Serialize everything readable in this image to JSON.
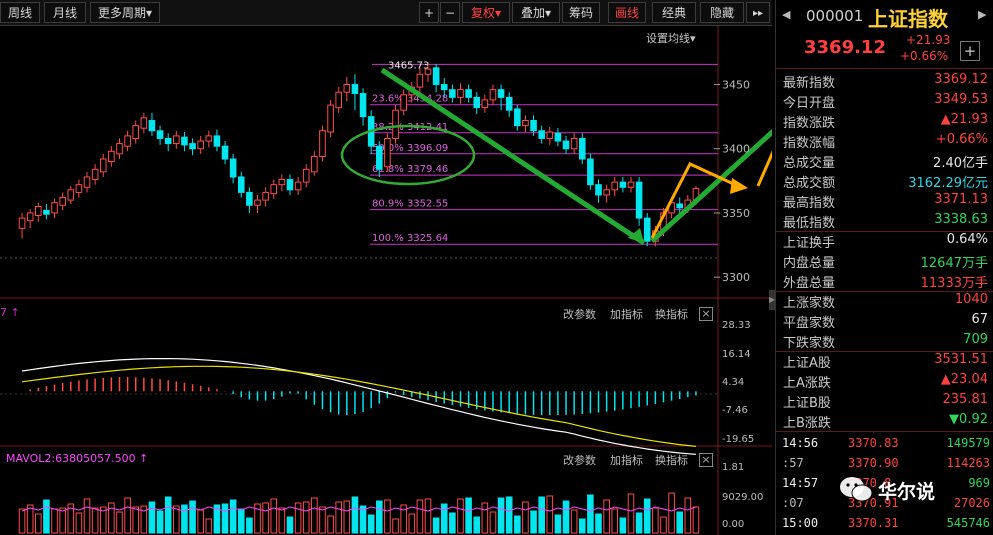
{
  "toolbar": {
    "week": "周线",
    "month": "月线",
    "more_period": "更多周期",
    "plus": "+",
    "minus": "−",
    "restore": "复权",
    "overlay": "叠加",
    "chips": "筹码",
    "draw": "画线",
    "classic": "经典",
    "hide": "隐藏",
    "arrow": "▸▸",
    "caret": "▾"
  },
  "ma_setting": "设置均线",
  "chart_data": [
    {
      "type": "candlestick",
      "title": "K线",
      "price_axis": {
        "ticks": [
          3450,
          3400,
          3350,
          3300
        ],
        "min": 3290,
        "max": 3480
      },
      "annotation_high": "3465.73",
      "fib_levels": [
        {
          "label": "23.6% 3434.28",
          "value": 3434.28
        },
        {
          "label": "38.2% 3412.41",
          "value": 3412.41
        },
        {
          "label": "50.0% 3396.09",
          "value": 3396.09
        },
        {
          "label": "61.8% 3379.46",
          "value": 3379.46
        },
        {
          "label": "80.9% 3352.55",
          "value": 3352.55
        },
        {
          "label": "100.% 3325.64",
          "value": 3325.64
        }
      ],
      "candles": [
        [
          3338,
          3346,
          3330,
          3350
        ],
        [
          3344,
          3350,
          3338,
          3353
        ],
        [
          3348,
          3355,
          3343,
          3358
        ],
        [
          3352,
          3349,
          3345,
          3357
        ],
        [
          3350,
          3358,
          3346,
          3361
        ],
        [
          3356,
          3362,
          3352,
          3366
        ],
        [
          3360,
          3368,
          3357,
          3371
        ],
        [
          3366,
          3372,
          3362,
          3376
        ],
        [
          3370,
          3378,
          3366,
          3382
        ],
        [
          3376,
          3384,
          3372,
          3388
        ],
        [
          3382,
          3392,
          3378,
          3396
        ],
        [
          3390,
          3398,
          3386,
          3402
        ],
        [
          3396,
          3404,
          3392,
          3408
        ],
        [
          3402,
          3410,
          3398,
          3414
        ],
        [
          3408,
          3418,
          3404,
          3422
        ],
        [
          3416,
          3424,
          3412,
          3428
        ],
        [
          3422,
          3414,
          3410,
          3428
        ],
        [
          3414,
          3408,
          3403,
          3418
        ],
        [
          3408,
          3404,
          3398,
          3412
        ],
        [
          3404,
          3410,
          3400,
          3414
        ],
        [
          3409,
          3403,
          3398,
          3413
        ],
        [
          3404,
          3400,
          3395,
          3408
        ],
        [
          3400,
          3406,
          3396,
          3410
        ],
        [
          3406,
          3410,
          3401,
          3414
        ],
        [
          3410,
          3402,
          3398,
          3415
        ],
        [
          3402,
          3392,
          3388,
          3406
        ],
        [
          3392,
          3378,
          3373,
          3396
        ],
        [
          3378,
          3366,
          3362,
          3382
        ],
        [
          3366,
          3356,
          3350,
          3370
        ],
        [
          3356,
          3360,
          3350,
          3364
        ],
        [
          3360,
          3366,
          3355,
          3370
        ],
        [
          3365,
          3372,
          3361,
          3376
        ],
        [
          3372,
          3376,
          3367,
          3380
        ],
        [
          3376,
          3368,
          3364,
          3380
        ],
        [
          3368,
          3374,
          3364,
          3378
        ],
        [
          3374,
          3384,
          3370,
          3388
        ],
        [
          3382,
          3394,
          3379,
          3398
        ],
        [
          3394,
          3414,
          3390,
          3418
        ],
        [
          3413,
          3434,
          3409,
          3438
        ],
        [
          3432,
          3444,
          3428,
          3448
        ],
        [
          3444,
          3450,
          3437,
          3456
        ],
        [
          3450,
          3443,
          3430,
          3458
        ],
        [
          3443,
          3425,
          3418,
          3447
        ],
        [
          3425,
          3402,
          3396,
          3430
        ],
        [
          3402,
          3384,
          3378,
          3406
        ],
        [
          3386,
          3408,
          3382,
          3412
        ],
        [
          3408,
          3430,
          3404,
          3434
        ],
        [
          3430,
          3442,
          3426,
          3446
        ],
        [
          3442,
          3448,
          3436,
          3452
        ],
        [
          3448,
          3458,
          3443,
          3463
        ],
        [
          3458,
          3462,
          3452,
          3466
        ],
        [
          3463,
          3450,
          3444,
          3466
        ],
        [
          3450,
          3446,
          3440,
          3455
        ],
        [
          3446,
          3440,
          3436,
          3450
        ],
        [
          3440,
          3446,
          3435,
          3451
        ],
        [
          3446,
          3440,
          3436,
          3450
        ],
        [
          3440,
          3432,
          3427,
          3444
        ],
        [
          3432,
          3438,
          3428,
          3442
        ],
        [
          3438,
          3446,
          3434,
          3450
        ],
        [
          3446,
          3440,
          3430,
          3450
        ],
        [
          3440,
          3430,
          3425,
          3444
        ],
        [
          3431,
          3418,
          3414,
          3434
        ],
        [
          3418,
          3422,
          3413,
          3426
        ],
        [
          3422,
          3414,
          3410,
          3426
        ],
        [
          3414,
          3408,
          3404,
          3418
        ],
        [
          3408,
          3413,
          3403,
          3417
        ],
        [
          3412,
          3406,
          3402,
          3416
        ],
        [
          3406,
          3400,
          3396,
          3410
        ],
        [
          3400,
          3408,
          3396,
          3412
        ],
        [
          3408,
          3392,
          3388,
          3412
        ],
        [
          3392,
          3372,
          3368,
          3396
        ],
        [
          3372,
          3364,
          3358,
          3376
        ],
        [
          3364,
          3368,
          3358,
          3372
        ],
        [
          3368,
          3374,
          3363,
          3378
        ],
        [
          3374,
          3370,
          3366,
          3378
        ],
        [
          3370,
          3374,
          3366,
          3378
        ],
        [
          3374,
          3346,
          3340,
          3378
        ],
        [
          3346,
          3328,
          3324,
          3350
        ],
        [
          3328,
          3336,
          3324,
          3340
        ],
        [
          3336,
          3350,
          3332,
          3354
        ],
        [
          3350,
          3358,
          3346,
          3362
        ],
        [
          3357,
          3354,
          3350,
          3362
        ],
        [
          3354,
          3360,
          3350,
          3364
        ],
        [
          3360,
          3369,
          3356,
          3371
        ]
      ]
    },
    {
      "type": "bar",
      "title": "MACD",
      "axis_ticks": [
        "28.33",
        "16.14",
        "4.34",
        "-7.46",
        "-19.65"
      ],
      "axis_values": [
        28.33,
        16.14,
        4.34,
        -7.46,
        -19.65
      ],
      "header": "7 ↑",
      "controls": [
        "改参数",
        "加指标",
        "换指标"
      ]
    },
    {
      "type": "bar",
      "title": "成交量",
      "header": "MAVOL2:63805057.500 ↑",
      "axis_ticks": [
        "1.81",
        "9029.00",
        "0.00"
      ],
      "controls": [
        "改参数",
        "加指标",
        "换指标"
      ]
    }
  ],
  "quote": {
    "code": "000001",
    "name": "上证指数",
    "price": "3369.12",
    "change": "+21.93",
    "change_pct": "+0.66%"
  },
  "stats": [
    {
      "k": "最新指数",
      "v": "3369.12",
      "c": "#ff4040"
    },
    {
      "k": "今日开盘",
      "v": "3349.53",
      "c": "#ff4040"
    },
    {
      "k": "指数涨跌",
      "v": "▲21.93",
      "c": "#ff4040"
    },
    {
      "k": "指数涨幅",
      "v": "+0.66%",
      "c": "#ff4040"
    },
    {
      "k": "总成交量",
      "v": "2.40亿手",
      "c": "#e6e6e6"
    },
    {
      "k": "总成交额",
      "v": "3162.29亿元",
      "c": "#2fd6e6"
    },
    {
      "k": "最高指数",
      "v": "3371.13",
      "c": "#ff4040"
    },
    {
      "k": "最低指数",
      "v": "3338.63",
      "c": "#2fd65a"
    },
    {
      "k": "上证换手",
      "v": "0.64%",
      "c": "#e6e6e6"
    },
    {
      "k": "内盘总量",
      "v": "12647万手",
      "c": "#2fd65a"
    },
    {
      "k": "外盘总量",
      "v": "11333万手",
      "c": "#ff4040"
    },
    {
      "k": "上涨家数",
      "v": "1040",
      "c": "#ff4040"
    },
    {
      "k": "平盘家数",
      "v": "67",
      "c": "#e6e6e6"
    },
    {
      "k": "下跌家数",
      "v": "709",
      "c": "#2fd65a"
    },
    {
      "k": "上证A股",
      "v": "3531.51",
      "c": "#ff4040"
    },
    {
      "k": "上A涨跌",
      "v": "▲23.04",
      "c": "#ff4040"
    },
    {
      "k": "上证B股",
      "v": "235.81",
      "c": "#ff4040"
    },
    {
      "k": "上B涨跌",
      "v": "▼0.92",
      "c": "#2fd65a"
    }
  ],
  "ticks": [
    {
      "t": "14:56",
      "p": "3370.83",
      "v": "149579"
    },
    {
      "t": ":57",
      "p": "3370.90",
      "v": "114263"
    },
    {
      "t": "14:57",
      "p": "3370.8",
      "v": "969"
    },
    {
      "t": ":07",
      "p": "3370.91",
      "v": "27026"
    },
    {
      "t": "15:00",
      "p": "3370.31",
      "v": "545746"
    }
  ],
  "watermark": "华尔说",
  "colors": {
    "up": "#ff4a4a",
    "down": "#00e5ee",
    "fib": "#cc33cc",
    "green_arrow": "#22aa33",
    "orange_arrow": "#ffaa00",
    "ellipse": "#33aa33"
  },
  "icons": {
    "left": "◀",
    "right": "▶",
    "add": "+",
    "close": "×"
  }
}
